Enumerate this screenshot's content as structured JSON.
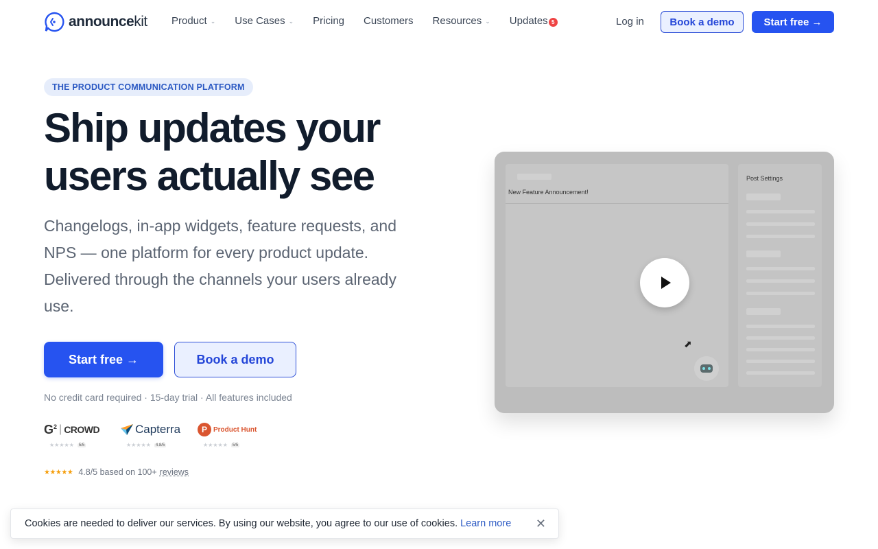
{
  "nav": {
    "logo_bold": "announce",
    "logo_thin": "kit",
    "items": [
      {
        "label": "Product",
        "dropdown": true
      },
      {
        "label": "Use Cases",
        "dropdown": true
      },
      {
        "label": "Pricing",
        "dropdown": false
      },
      {
        "label": "Customers",
        "dropdown": false
      },
      {
        "label": "Resources",
        "dropdown": true
      },
      {
        "label": "Updates",
        "dropdown": false
      }
    ],
    "updates_badge": "5",
    "login": "Log in",
    "book_demo": "Book a demo",
    "start_free": "Start free →"
  },
  "hero": {
    "eyebrow": "THE PRODUCT COMMUNICATION PLATFORM",
    "headline_1": "Ship updates your",
    "headline_2": "users actually see",
    "subhead": "Changelogs, in-app widgets, feature requests, and NPS — one platform for every product update. Delivered through the channels your users already use.",
    "cta_primary": "Start free →",
    "cta_secondary": "Book a demo",
    "fineprint": "No credit card required · 15-day trial · All features included"
  },
  "reviews": {
    "logos": [
      {
        "name": "G2 CROWD",
        "score": "5/5"
      },
      {
        "name": "Capterra",
        "score": "4.8/5"
      },
      {
        "name": "Product Hunt",
        "score": "5/5"
      }
    ],
    "stars": "★★★★★",
    "summary": "4.8/5 based on 100+",
    "link": "reviews"
  },
  "video": {
    "editor_title": "New Feature Announcement!",
    "settings_title": "Post Settings",
    "play_icon": "play-icon"
  },
  "cookie": {
    "text": "Cookies are needed to deliver our services. By using our website, you agree to our use of cookies.",
    "learn_more": "Learn more",
    "close": "✕"
  },
  "colors": {
    "brand": "#2653f0",
    "headline": "#111c2c",
    "badge": "#ef4444"
  }
}
